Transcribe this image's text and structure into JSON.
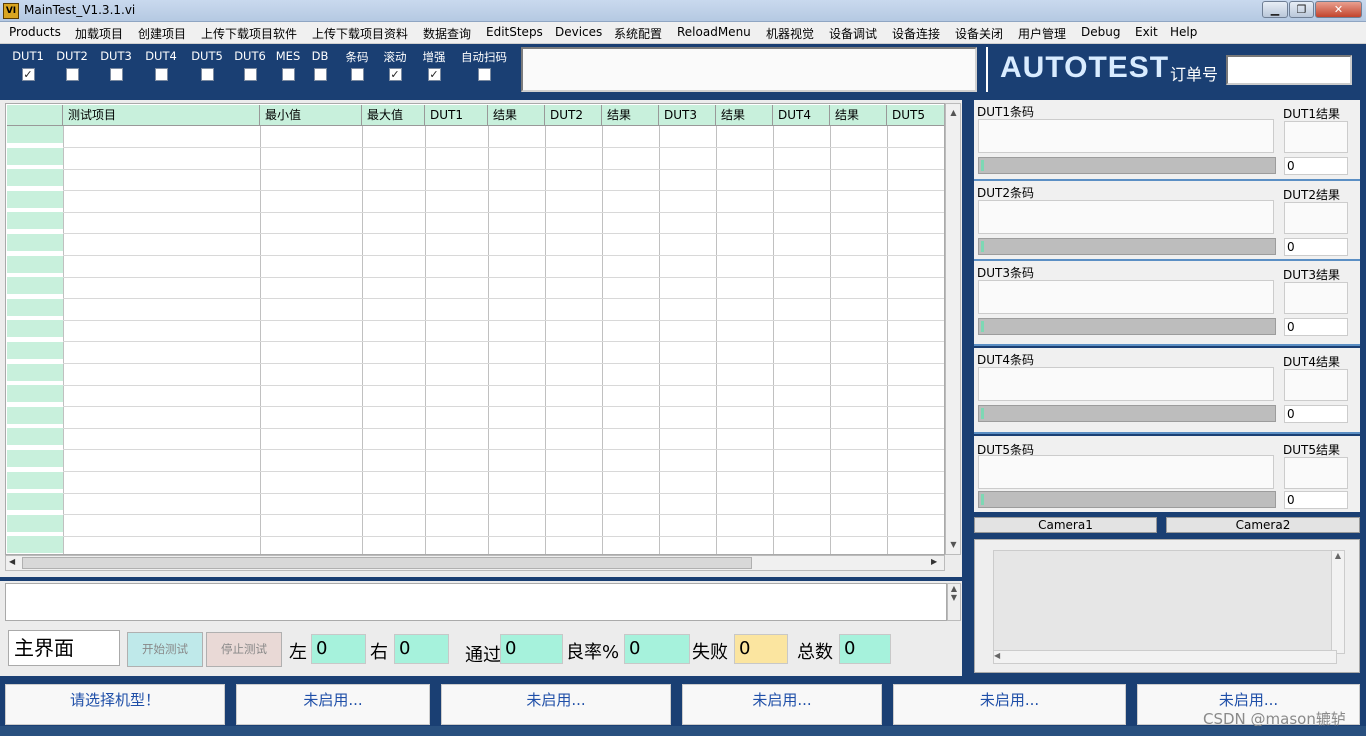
{
  "window": {
    "title": "MainTest_V1.3.1.vi",
    "app_icon": "VI",
    "minimize": "▁",
    "restore": "❐",
    "close": "✕"
  },
  "menu": [
    "Products",
    "加载项目",
    "创建项目",
    "上传下载项目软件",
    "上传下载项目资料",
    "数据查询",
    "EditSteps",
    "Devices",
    "系统配置",
    "ReloadMenu",
    "机器视觉",
    "设备调试",
    "设备连接",
    "设备关闭",
    "用户管理",
    "Debug",
    "Exit",
    "Help"
  ],
  "toggles": [
    {
      "label": "DUT1",
      "checked": "✓"
    },
    {
      "label": "DUT2",
      "checked": ""
    },
    {
      "label": "DUT3",
      "checked": ""
    },
    {
      "label": "DUT4",
      "checked": ""
    },
    {
      "label": "DUT5",
      "checked": ""
    },
    {
      "label": "DUT6",
      "checked": ""
    },
    {
      "label": "MES",
      "checked": ""
    },
    {
      "label": "DB",
      "checked": ""
    },
    {
      "label": "条码",
      "checked": ""
    },
    {
      "label": "滚动",
      "checked": "✓"
    },
    {
      "label": "增强",
      "checked": "✓"
    },
    {
      "label": "自动扫码",
      "checked": ""
    }
  ],
  "header": {
    "title": "AUTOTEST",
    "order_label": "订单号",
    "order_value": ""
  },
  "table": {
    "columns": [
      "",
      "测试项目",
      "最小值",
      "最大值",
      "DUT1",
      "结果",
      "DUT2",
      "结果",
      "DUT3",
      "结果",
      "DUT4",
      "结果",
      "DUT5"
    ],
    "rows": []
  },
  "controls": {
    "main_label": "主界面",
    "start_button": "开始测试",
    "stop_button": "停止测试"
  },
  "stats": {
    "left_label": "左",
    "left_value": "0",
    "right_label": "右",
    "right_value": "0",
    "pass_label": "通过",
    "pass_value": "0",
    "yield_label": "良率%",
    "yield_value": "0",
    "fail_label": "失败",
    "fail_value": "0",
    "total_label": "总数",
    "total_value": "0"
  },
  "duts": [
    {
      "barcode_label": "DUT1条码",
      "result_label": "DUT1结果",
      "value": "0"
    },
    {
      "barcode_label": "DUT2条码",
      "result_label": "DUT2结果",
      "value": "0"
    },
    {
      "barcode_label": "DUT3条码",
      "result_label": "DUT3结果",
      "value": "0"
    },
    {
      "barcode_label": "DUT4条码",
      "result_label": "DUT4结果",
      "value": "0"
    },
    {
      "barcode_label": "DUT5条码",
      "result_label": "DUT5结果",
      "value": "0"
    }
  ],
  "camera": {
    "tab1": "Camera1",
    "tab2": "Camera2"
  },
  "status_boxes": [
    "请选择机型！",
    "未启用...",
    "未启用...",
    "未启用...",
    "未启用...",
    "未启用..."
  ],
  "watermark": "CSDN @mason辘轳",
  "colors": {
    "panel_blue": "#1a3f73",
    "header_green": "#c8f0dc",
    "value_green": "#a6f2dc",
    "fail_yellow": "#fbe5a0"
  }
}
